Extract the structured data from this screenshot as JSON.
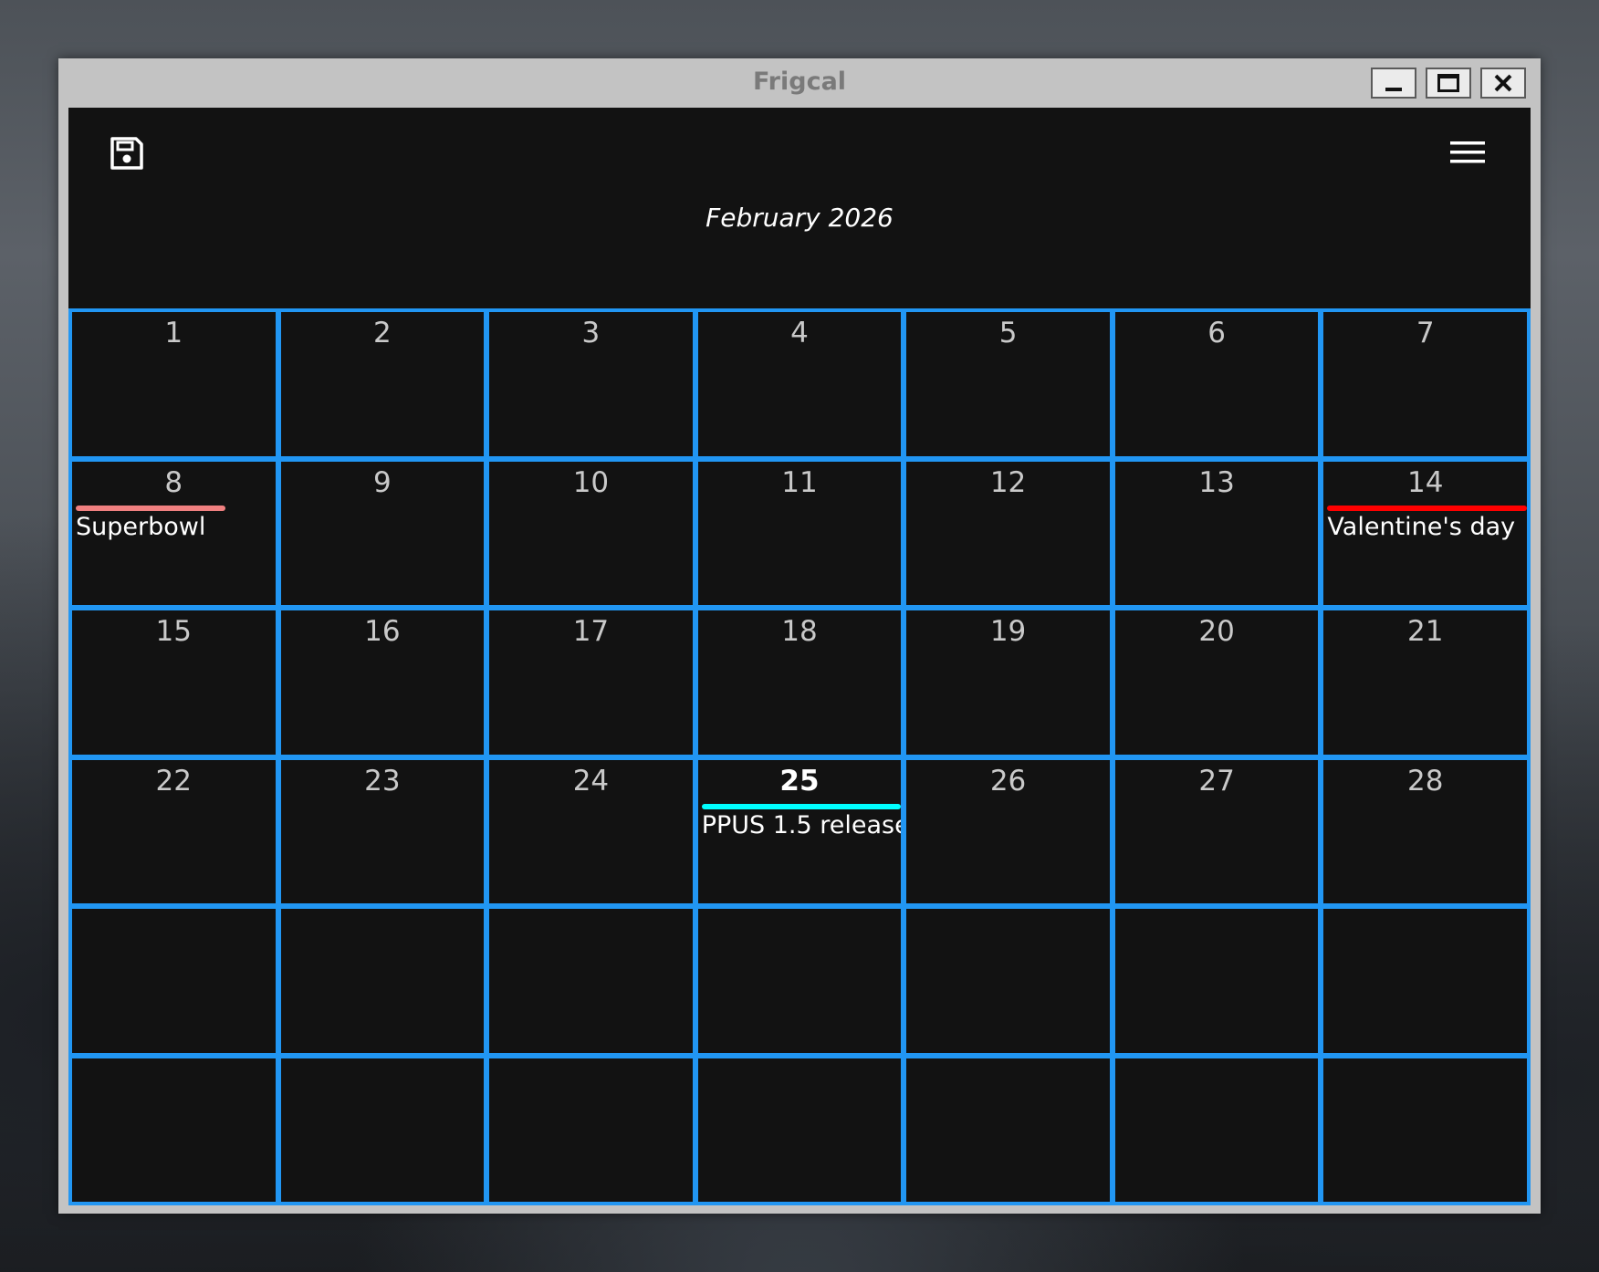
{
  "window": {
    "title": "Frigcal"
  },
  "toolbar": {
    "save_icon": "save-icon",
    "menu_icon": "hamburger-menu-icon"
  },
  "calendar": {
    "month_label": "February 2026",
    "today": 25,
    "grid_color": "#2196f3",
    "background": "#121212",
    "weeks": [
      [
        {
          "day": "1"
        },
        {
          "day": "2"
        },
        {
          "day": "3"
        },
        {
          "day": "4"
        },
        {
          "day": "5"
        },
        {
          "day": "6"
        },
        {
          "day": "7"
        }
      ],
      [
        {
          "day": "8",
          "event": {
            "label": "Superbowl",
            "color": "#f08080",
            "bar_fraction": 0.75
          }
        },
        {
          "day": "9"
        },
        {
          "day": "10"
        },
        {
          "day": "11"
        },
        {
          "day": "12"
        },
        {
          "day": "13"
        },
        {
          "day": "14",
          "event": {
            "label": "Valentine's day",
            "color": "#ff0000",
            "bar_fraction": 1
          }
        }
      ],
      [
        {
          "day": "15"
        },
        {
          "day": "16"
        },
        {
          "day": "17"
        },
        {
          "day": "18"
        },
        {
          "day": "19"
        },
        {
          "day": "20"
        },
        {
          "day": "21"
        }
      ],
      [
        {
          "day": "22"
        },
        {
          "day": "23"
        },
        {
          "day": "24"
        },
        {
          "day": "25",
          "today": true,
          "event": {
            "label": "PPUS 1.5 release",
            "color": "#00ffff",
            "bar_fraction": 1
          }
        },
        {
          "day": "26"
        },
        {
          "day": "27"
        },
        {
          "day": "28"
        }
      ],
      [
        {
          "day": ""
        },
        {
          "day": ""
        },
        {
          "day": ""
        },
        {
          "day": ""
        },
        {
          "day": ""
        },
        {
          "day": ""
        },
        {
          "day": ""
        }
      ],
      [
        {
          "day": ""
        },
        {
          "day": ""
        },
        {
          "day": ""
        },
        {
          "day": ""
        },
        {
          "day": ""
        },
        {
          "day": ""
        },
        {
          "day": ""
        }
      ]
    ]
  }
}
